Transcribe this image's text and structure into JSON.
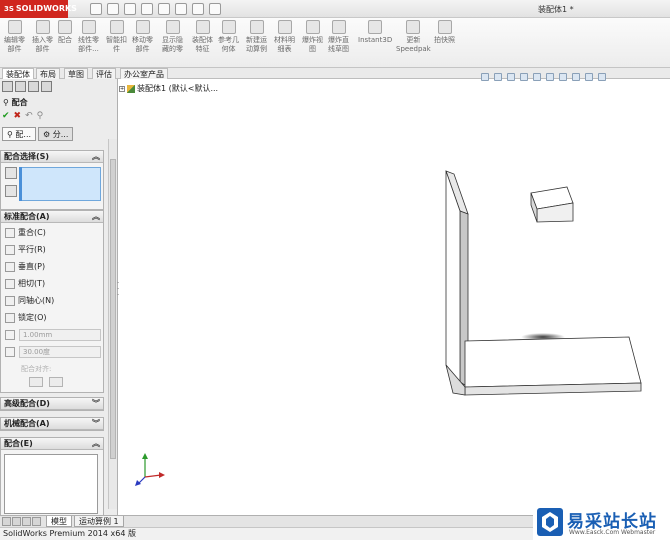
{
  "window": {
    "logo_prefix": "3S",
    "logo_text": "SOLIDWORKS",
    "doc_title": "装配体1 *"
  },
  "ribbon": {
    "buttons": [
      {
        "label1": "编辑零",
        "label2": "部件"
      },
      {
        "label1": "插入零",
        "label2": "部件"
      },
      {
        "label1": "配合",
        "label2": ""
      },
      {
        "label1": "线性零",
        "label2": "部件..."
      },
      {
        "label1": "智能扣",
        "label2": "件"
      },
      {
        "label1": "移动零",
        "label2": "部件"
      },
      {
        "label1": "显示隐",
        "label2": "藏的零"
      },
      {
        "label1": "装配体",
        "label2": "特征"
      },
      {
        "label1": "参考几",
        "label2": "何体"
      },
      {
        "label1": "新建运",
        "label2": "动算例"
      },
      {
        "label1": "材料明",
        "label2": "细表"
      },
      {
        "label1": "爆炸视",
        "label2": "图"
      },
      {
        "label1": "爆炸直",
        "label2": "线草图"
      },
      {
        "label1": "Instant3D",
        "label2": ""
      },
      {
        "label1": "更新",
        "label2": "Speedpak"
      },
      {
        "label1": "拍快照",
        "label2": ""
      }
    ]
  },
  "command_tabs": [
    "装配体",
    "布局",
    "草图",
    "评估",
    "办公室产品"
  ],
  "property_manager": {
    "title": "配合",
    "tab_mates": "配...",
    "tab_analysis": "分...",
    "mate_selections_title": "配合选择(S)",
    "standard_mates_title": "标准配合(A)",
    "standard_mates": [
      "重合(C)",
      "平行(R)",
      "垂直(P)",
      "相切(T)",
      "同轴心(N)",
      "锁定(O)"
    ],
    "distance_value": "1.00mm",
    "angle_value": "30.00度",
    "alignment_label": "配合对齐:",
    "advanced_mates_title": "高级配合(D)",
    "mechanical_mates_title": "机械配合(A)",
    "mates_title": "配合(E)"
  },
  "tree": {
    "root_label": "装配体1 (默认<默认..."
  },
  "bottom_tabs": [
    "模型",
    "运动算例 1"
  ],
  "status": {
    "text": "SolidWorks Premium 2014 x64 版"
  },
  "watermark": {
    "text": "易采站长站",
    "url": "Www.Easck.Com Webmaster"
  },
  "colors": {
    "brand_red": "#d0261e",
    "selection_blue": "#cfe6fb",
    "watermark_blue": "#1a5fb4"
  }
}
